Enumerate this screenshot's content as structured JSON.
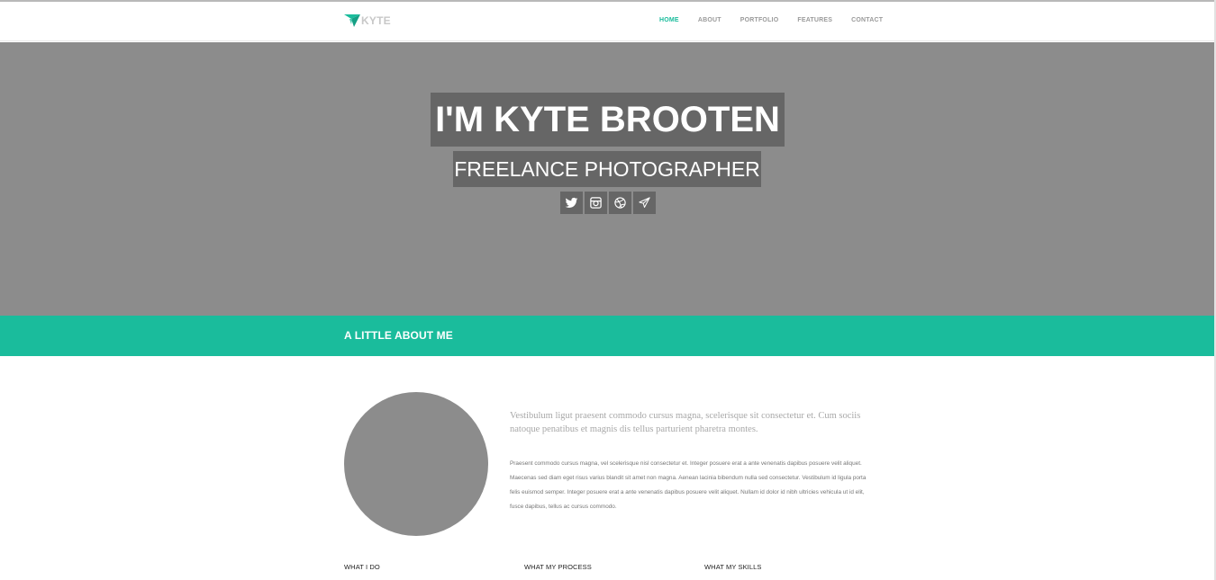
{
  "brand": {
    "name": "KYTE",
    "icon": "paper-plane-logo-icon",
    "accent": "#1abc9c"
  },
  "nav": {
    "items": [
      {
        "label": "HOME",
        "active": true
      },
      {
        "label": "ABOUT",
        "active": false
      },
      {
        "label": "PORTFOLIO",
        "active": false
      },
      {
        "label": "FEATURES",
        "active": false
      },
      {
        "label": "CONTACT",
        "active": false
      }
    ]
  },
  "hero": {
    "title": "I'M KYTE BROOTEN",
    "subtitle": "FREELANCE PHOTOGRAPHER",
    "social": [
      {
        "icon": "twitter-icon"
      },
      {
        "icon": "instagram-icon"
      },
      {
        "icon": "dribbble-icon"
      },
      {
        "icon": "paper-plane-icon"
      }
    ]
  },
  "about": {
    "heading": "A LITTLE ABOUT ME",
    "lead": "Vestibulum ligut praesent commodo cursus magna, scelerisque sit consectetur et. Cum sociis natoque penatibus et magnis dis tellus parturient pharetra montes.",
    "body": "Praesent commodo cursus magna, vel scelerisque nisl consectetur et. Integer posuere erat a ante venenatis dapibus posuere velit aliquet. Maecenas sed diam eget risus varius blandit sit amet non magna. Aenean lacinia bibendum nulla sed consectetur. Vestibulum id ligula porta felis euismod semper. Integer posuere erat a ante venenatis dapibus posuere velit aliquet. Nullam id dolor id nibh ultricies vehicula ut id elit, fusce dapibus, tellus ac cursus commodo.",
    "columns": [
      {
        "heading": "WHAT I DO"
      },
      {
        "heading": "WHAT MY PROCESS"
      },
      {
        "heading": "WHAT MY SKILLS"
      }
    ]
  }
}
